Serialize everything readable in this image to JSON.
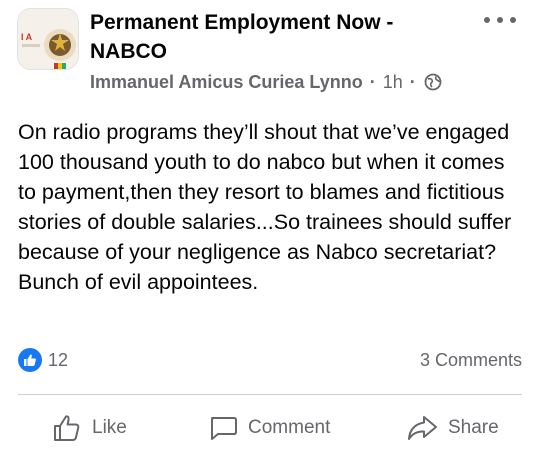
{
  "post": {
    "group_name": "Permanent Employment Now - NABCO",
    "author": "Immanuel Amicus Curiea Lynno",
    "time": "1h",
    "separator": "·",
    "audience_icon": "globe-icon",
    "body": "On radio programs they’ll shout that we’ve engaged 100 thousand youth to do nabco but when it comes to payment,then they resort to blames and fictitious stories of double salaries...So trainees should suffer because of your negligence as Nabco secretariat? Bunch of evil appointees."
  },
  "engagement": {
    "reaction_icon": "thumbs-up-icon",
    "reaction_count": "12",
    "comments_text": "3 Comments"
  },
  "actions": {
    "like_label": "Like",
    "comment_label": "Comment",
    "share_label": "Share"
  },
  "colors": {
    "accent": "#1877f2",
    "secondary_text": "#65676b",
    "primary_text": "#050505",
    "divider": "#ced0d4"
  }
}
